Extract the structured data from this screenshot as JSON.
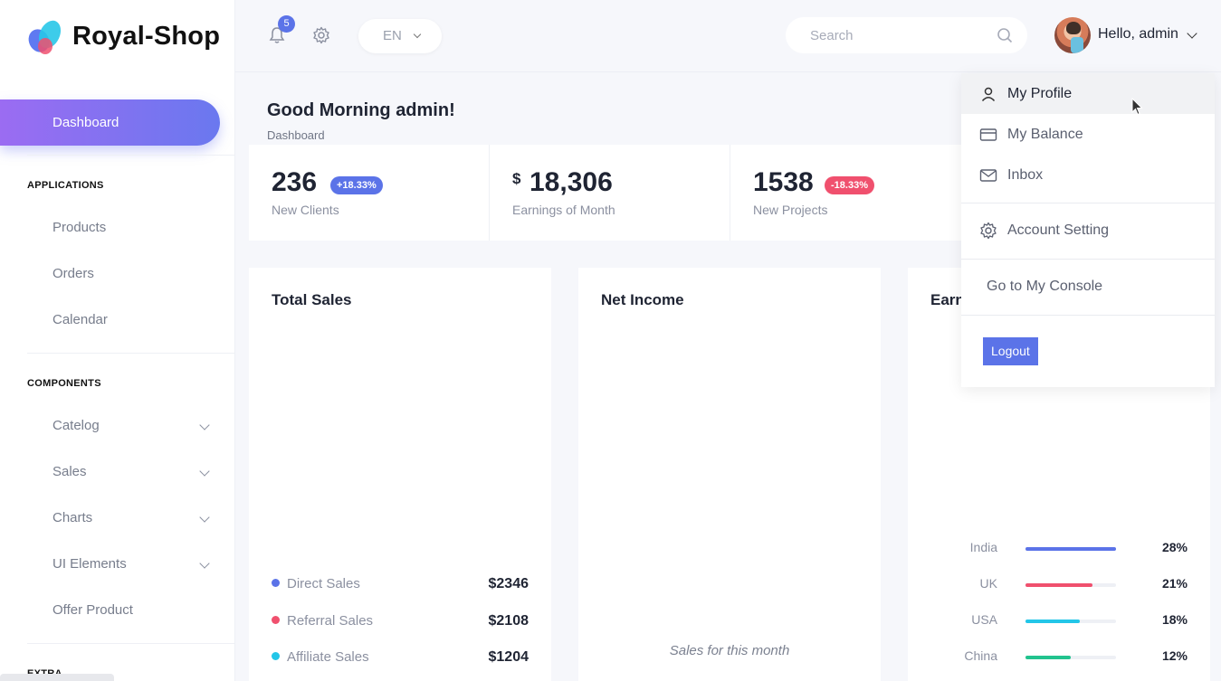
{
  "brand": {
    "name": "Royal-Shop"
  },
  "sidebar": {
    "active_label": "Dashboard",
    "section_applications": "APPLICATIONS",
    "applications": [
      "Products",
      "Orders",
      "Calendar"
    ],
    "section_components": "COMPONENTS",
    "components": [
      "Catelog",
      "Sales",
      "Charts",
      "UI Elements",
      "Offer Product"
    ],
    "section_extra": "EXTRA"
  },
  "header": {
    "notification_count": "5",
    "language": "EN",
    "search_placeholder": "Search",
    "greeting": "Hello, admin"
  },
  "page": {
    "title": "Good Morning admin!",
    "breadcrumb": "Dashboard"
  },
  "stats": [
    {
      "value": "236",
      "label": "New Clients",
      "badge": "+18.33%",
      "badge_color": "#5b73e8"
    },
    {
      "currency": "$",
      "value": "18,306",
      "label": "Earnings of Month"
    },
    {
      "value": "1538",
      "label": "New Projects",
      "badge": "-18.33%",
      "badge_color": "#f0506e"
    }
  ],
  "total_sales": {
    "title": "Total Sales",
    "legend": [
      {
        "label": "Direct Sales",
        "value": "$2346",
        "color": "#5b73e8"
      },
      {
        "label": "Referral Sales",
        "value": "$2108",
        "color": "#f0506e"
      },
      {
        "label": "Affiliate Sales",
        "value": "$1204",
        "color": "#23c6e8"
      }
    ]
  },
  "net_income": {
    "title": "Net Income",
    "note": "Sales for this month"
  },
  "earnings": {
    "title": "Earn",
    "rows": [
      {
        "country": "India",
        "percent": "28%",
        "fill": 1.0,
        "color": "#5b73e8"
      },
      {
        "country": "UK",
        "percent": "21%",
        "fill": 0.74,
        "color": "#f0506e"
      },
      {
        "country": "USA",
        "percent": "18%",
        "fill": 0.6,
        "color": "#23c6e8"
      },
      {
        "country": "China",
        "percent": "12%",
        "fill": 0.5,
        "color": "#22c38e"
      }
    ]
  },
  "user_menu": {
    "my_profile": "My Profile",
    "my_balance": "My Balance",
    "inbox": "Inbox",
    "account_setting": "Account Setting",
    "console": "Go to My Console",
    "logout": "Logout"
  }
}
